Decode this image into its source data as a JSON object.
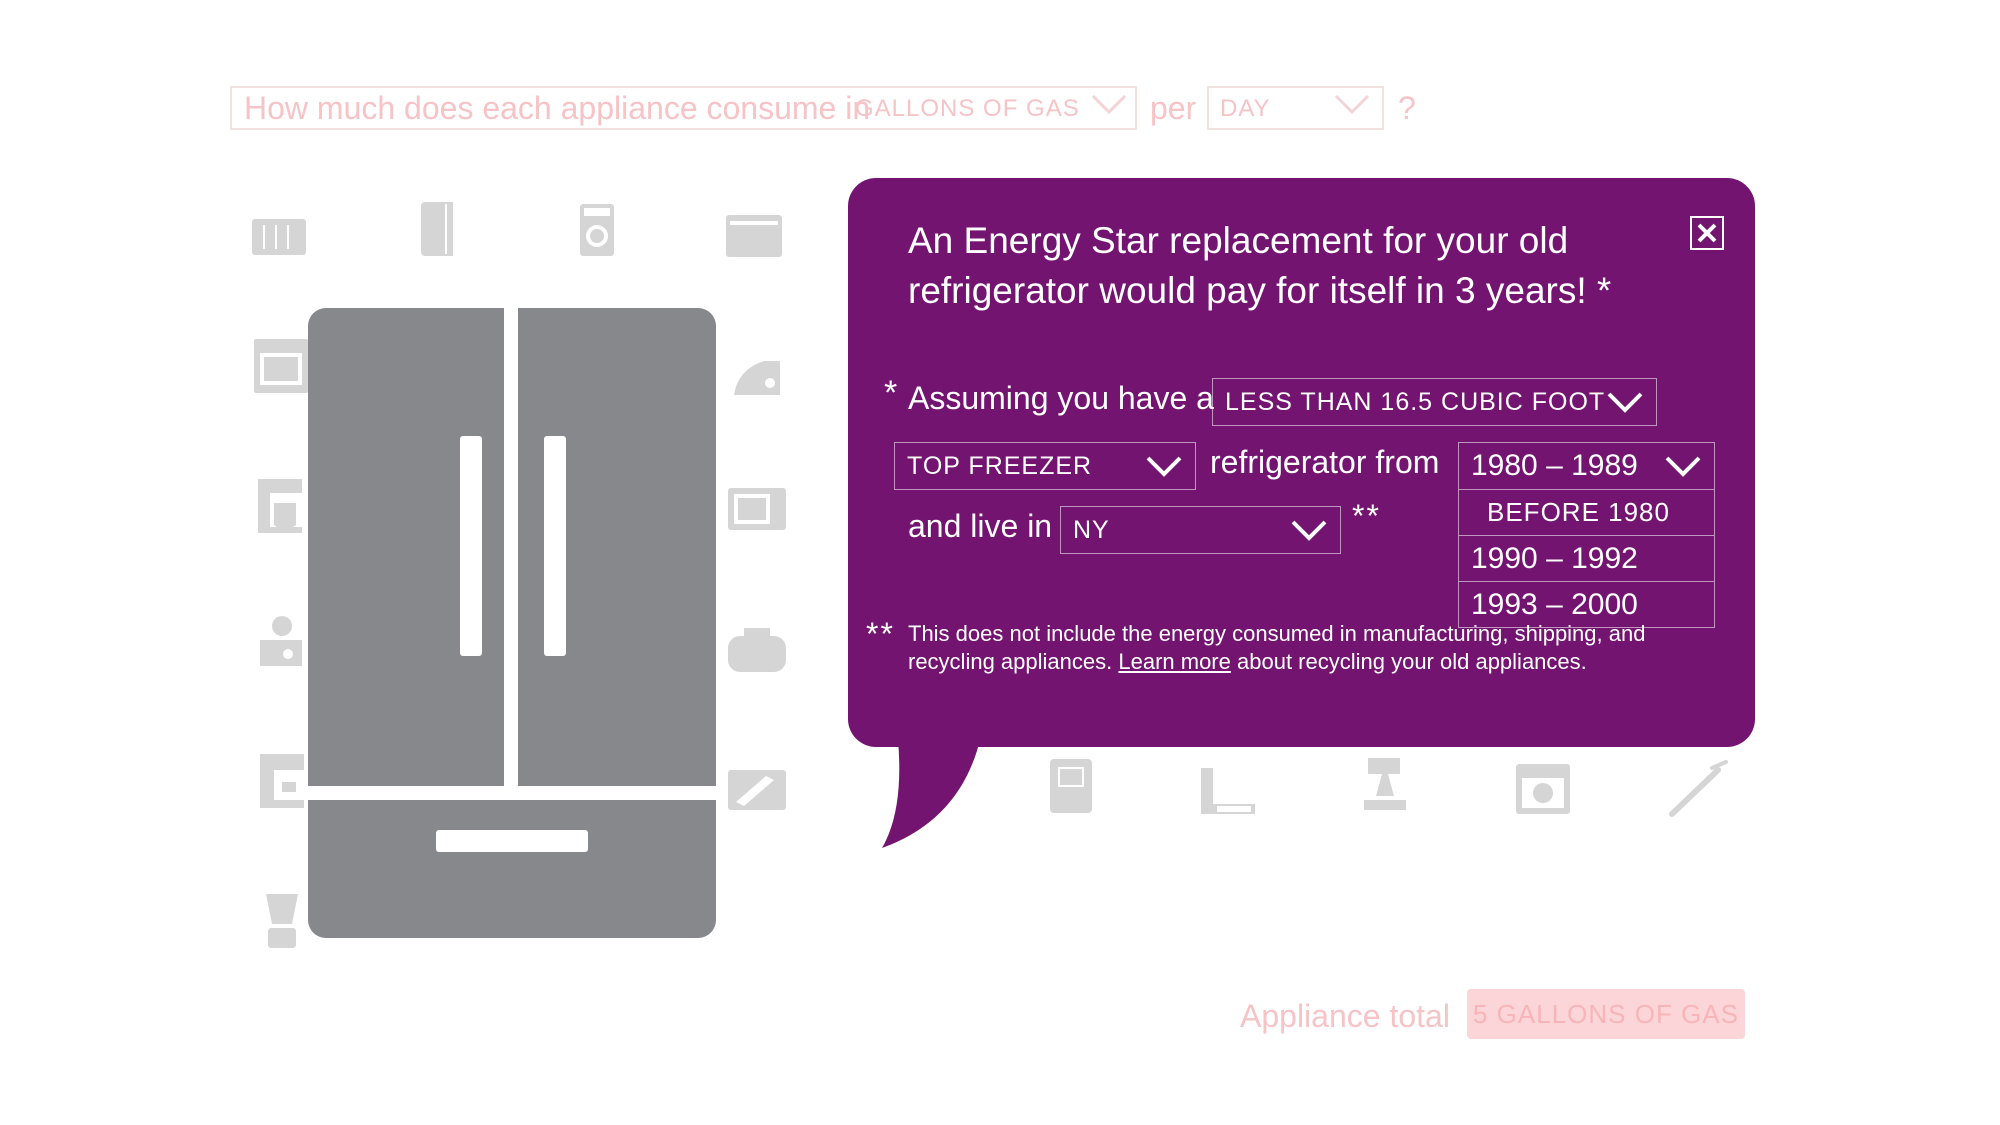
{
  "header_question": {
    "text": "How much does each appliance consume in",
    "unit": "GALLONS OF GAS",
    "per": "per",
    "period": "DAY",
    "question_mark": "?"
  },
  "popup": {
    "headline": "An Energy Star replacement for your old refrigerator would pay for itself in 3 years! *",
    "close_label": "×",
    "assumption_star": "*",
    "assuming_text": "Assuming you have a",
    "size_select": {
      "value": "LESS THAN 16.5 CUBIC FOOT"
    },
    "style_select": {
      "value": "TOP FREEZER"
    },
    "from_text": "refrigerator from",
    "year_select": {
      "value": "1980 – 1989",
      "options": [
        "BEFORE 1980",
        "1990 – 1992",
        "1993 – 2000"
      ]
    },
    "live_text": "and live in",
    "state_select": {
      "value": "NY"
    },
    "double_star": "**",
    "footnote": {
      "stars": "**",
      "text_part1": "This does not include the energy consumed in manufacturing, shipping, and recycling appliances.",
      "link": "Learn more",
      "text_part2": "about recycling your old appliances."
    }
  },
  "footer": {
    "total_label": "Appliance total",
    "total_value": "5 GALLONS OF GAS"
  },
  "colors": {
    "popup_bg": "#731471",
    "fridge_gray": "#87888c",
    "faded_text": "#f6c3c6"
  },
  "icons": [
    "window-ac-icon",
    "space-heater-icon",
    "washer-icon",
    "chest-freezer-icon",
    "oven-icon",
    "iron-icon",
    "coffee-maker-icon",
    "microwave-icon",
    "slow-cooker-icon",
    "toaster-icon",
    "espresso-machine-icon",
    "toaster-oven-icon",
    "blender-icon",
    "dehumidifier-icon",
    "water-heater-icon",
    "stand-mixer-icon",
    "dishwasher-icon",
    "curling-iron-icon",
    "refrigerator-icon",
    "close-icon",
    "chevron-down-icon"
  ]
}
